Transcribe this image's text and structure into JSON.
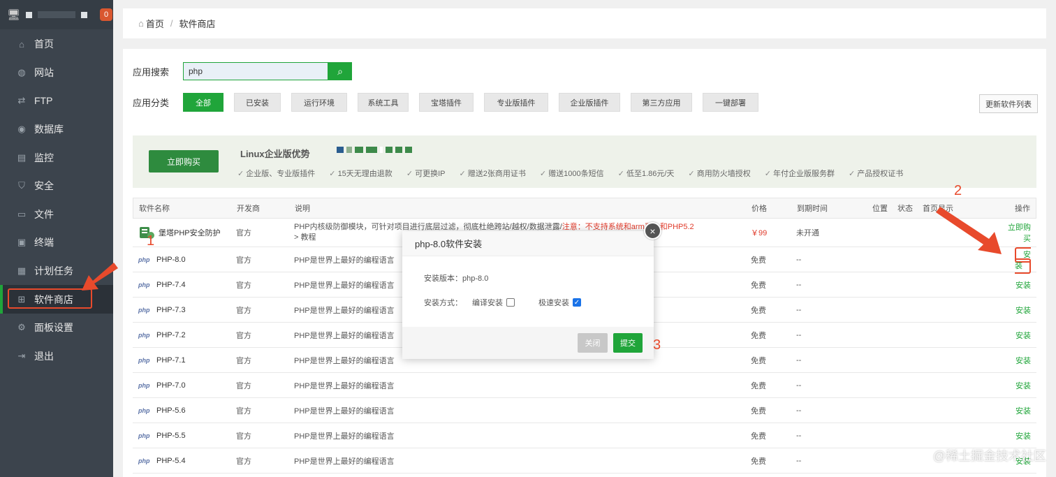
{
  "sidebar": {
    "badge": "0",
    "items": [
      {
        "label": "首页",
        "icon": "home-icon",
        "glyph": "⌂"
      },
      {
        "label": "网站",
        "icon": "globe-icon",
        "glyph": "◍"
      },
      {
        "label": "FTP",
        "icon": "ftp-icon",
        "glyph": "⇄"
      },
      {
        "label": "数据库",
        "icon": "database-icon",
        "glyph": "◉"
      },
      {
        "label": "监控",
        "icon": "monitor-icon",
        "glyph": "▤"
      },
      {
        "label": "安全",
        "icon": "shield-icon",
        "glyph": "⛉"
      },
      {
        "label": "文件",
        "icon": "folder-icon",
        "glyph": "▭"
      },
      {
        "label": "终端",
        "icon": "terminal-icon",
        "glyph": "▣"
      },
      {
        "label": "计划任务",
        "icon": "calendar-icon",
        "glyph": "▦"
      },
      {
        "label": "软件商店",
        "icon": "grid-icon",
        "glyph": "⊞",
        "active": true
      },
      {
        "label": "面板设置",
        "icon": "gear-icon",
        "glyph": "⚙"
      },
      {
        "label": "退出",
        "icon": "logout-icon",
        "glyph": "⇥"
      }
    ]
  },
  "breadcrumb": {
    "home": "首页",
    "sep": "/",
    "current": "软件商店"
  },
  "search": {
    "label": "应用搜索",
    "value": "php"
  },
  "category": {
    "label": "应用分类",
    "buttons": [
      "全部",
      "已安装",
      "运行环境",
      "系统工具",
      "宝塔插件",
      "专业版插件",
      "企业版插件",
      "第三方应用",
      "一键部署"
    ],
    "refresh": "更新软件列表"
  },
  "promo": {
    "buy": "立即购买",
    "title": "Linux企业版优势",
    "perks": [
      "企业版、专业版插件",
      "15天无理由退款",
      "可更换IP",
      "赠送2张商用证书",
      "赠送1000条短信",
      "低至1.86元/天",
      "商用防火墙授权",
      "年付企业版服务群",
      "产品授权证书"
    ]
  },
  "table": {
    "headers": {
      "name": "软件名称",
      "dev": "开发商",
      "desc": "说明",
      "price": "价格",
      "expire": "到期时间",
      "pos": "位置",
      "state": "状态",
      "home": "首页显示",
      "op": "操作"
    },
    "first": {
      "name": "堡塔PHP安全防护",
      "dev": "官方",
      "desc": "PHP内核级防御模块，可针对项目进行底层过滤，彻底杜绝跨站/越权/数据泄露/",
      "desc_warn": "注意：不支持",
      "desc_tail": "系统和arm平台和PHP5.2",
      "desc_link": "> 教程",
      "price": "￥99",
      "expire": "未开通",
      "op": "立即购买"
    },
    "rows": [
      {
        "name": "PHP-8.0",
        "dev": "官方",
        "desc": "PHP是世界上最好的编程语言",
        "price": "免费",
        "expire": "--",
        "op": "安装"
      },
      {
        "name": "PHP-7.4",
        "dev": "官方",
        "desc": "PHP是世界上最好的编程语言",
        "price": "免费",
        "expire": "--",
        "op": "安装"
      },
      {
        "name": "PHP-7.3",
        "dev": "官方",
        "desc": "PHP是世界上最好的编程语言",
        "price": "免费",
        "expire": "--",
        "op": "安装"
      },
      {
        "name": "PHP-7.2",
        "dev": "官方",
        "desc": "PHP是世界上最好的编程语言",
        "price": "免费",
        "expire": "--",
        "op": "安装"
      },
      {
        "name": "PHP-7.1",
        "dev": "官方",
        "desc": "PHP是世界上最好的编程语言",
        "price": "免费",
        "expire": "--",
        "op": "安装"
      },
      {
        "name": "PHP-7.0",
        "dev": "官方",
        "desc": "PHP是世界上最好的编程语言",
        "price": "免费",
        "expire": "--",
        "op": "安装"
      },
      {
        "name": "PHP-5.6",
        "dev": "官方",
        "desc": "PHP是世界上最好的编程语言",
        "price": "免费",
        "expire": "--",
        "op": "安装"
      },
      {
        "name": "PHP-5.5",
        "dev": "官方",
        "desc": "PHP是世界上最好的编程语言",
        "price": "免费",
        "expire": "--",
        "op": "安装"
      },
      {
        "name": "PHP-5.4",
        "dev": "官方",
        "desc": "PHP是世界上最好的编程语言",
        "price": "免费",
        "expire": "--",
        "op": "安装"
      }
    ],
    "php_logo": "php"
  },
  "modal": {
    "title": "php-8.0软件安装",
    "version_label": "安装版本：php-8.0",
    "method_label": "安装方式：",
    "compile": "编译安装",
    "compile_checked": false,
    "fast": "极速安装",
    "fast_checked": true,
    "close": "关闭",
    "submit": "提交",
    "close_icon": "×"
  },
  "annotations": [
    "1",
    "2",
    "3"
  ],
  "watermark": "@稀土掘金技术社区",
  "colors": {
    "accent": "#20a53a",
    "sidebar": "#3c444d",
    "annotation": "#e84a2c"
  }
}
